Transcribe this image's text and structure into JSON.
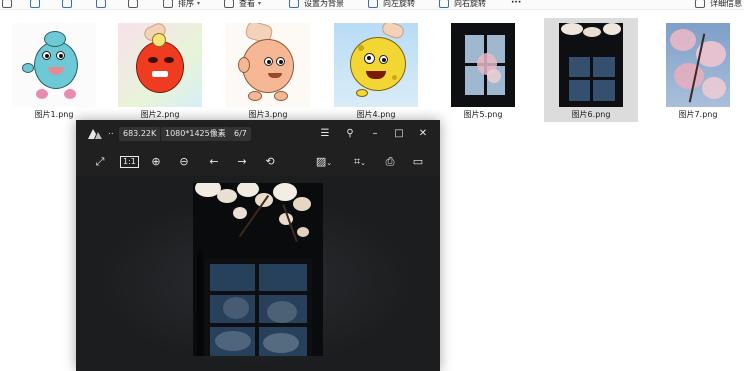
{
  "toolbar": {
    "sort_label": "排序",
    "view_label": "查看",
    "set_bg_label": "设置为背景",
    "rotate_left_label": "向左旋转",
    "rotate_right_label": "向右旋转",
    "more_label": "···",
    "details_label": "详细信息"
  },
  "files": [
    {
      "name": "图片1.png",
      "kind": "cartoon-blue"
    },
    {
      "name": "图片2.png",
      "kind": "cartoon-red"
    },
    {
      "name": "图片3.png",
      "kind": "cartoon-peach"
    },
    {
      "name": "图片4.png",
      "kind": "cartoon-yellow"
    },
    {
      "name": "图片5.png",
      "kind": "photo-window-blossom"
    },
    {
      "name": "图片6.png",
      "kind": "photo-window-blossom",
      "selected": true
    },
    {
      "name": "图片7.png",
      "kind": "photo-blossom-sky"
    }
  ],
  "viewer": {
    "more_dots": "..",
    "file_size": "683.22K",
    "dimensions": "1080*1425像素",
    "position": "6/7",
    "accent_color": "#2b2b2b"
  }
}
